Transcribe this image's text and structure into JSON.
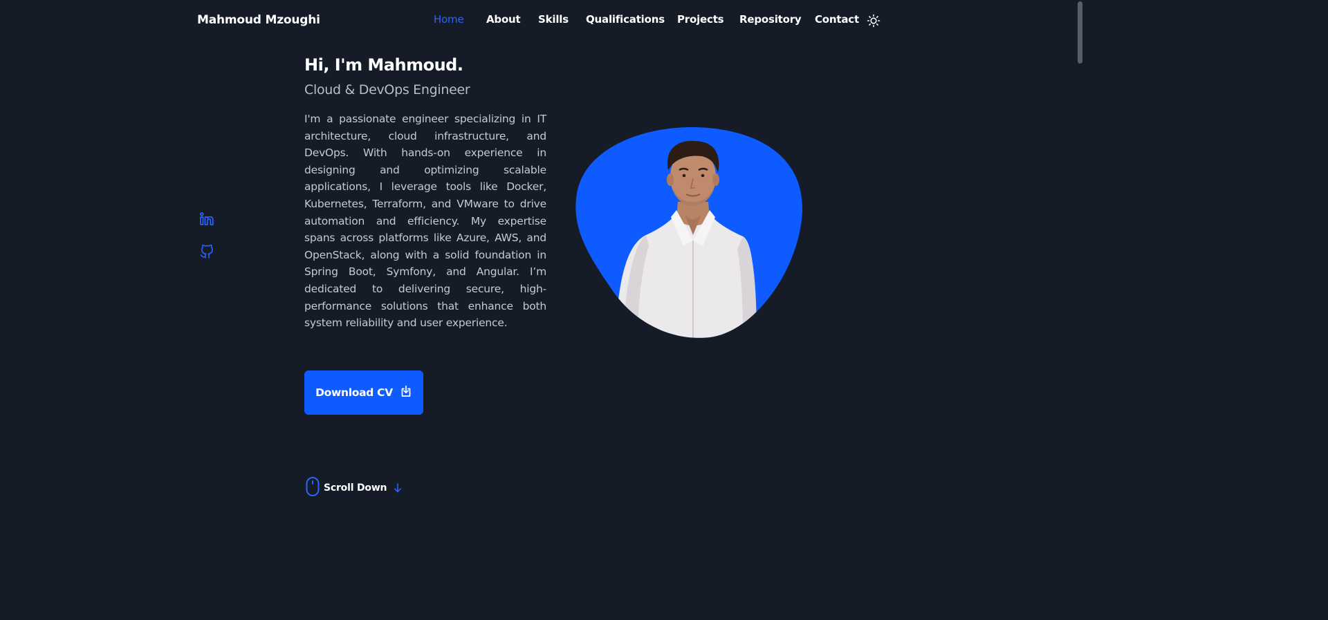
{
  "header": {
    "brand": "Mahmoud Mzoughi",
    "nav": [
      {
        "label": "Home",
        "active": true
      },
      {
        "label": "About",
        "active": false
      },
      {
        "label": "Skills",
        "active": false
      },
      {
        "label": "Qualifications",
        "active": false
      },
      {
        "label": "Projects",
        "active": false
      },
      {
        "label": "Repository",
        "active": false
      },
      {
        "label": "Contact",
        "active": false
      }
    ],
    "theme_icon": "sun-icon"
  },
  "socials": [
    {
      "icon": "linkedin-icon"
    },
    {
      "icon": "github-icon"
    }
  ],
  "hero": {
    "title": "Hi, I'm Mahmoud.",
    "subtitle": "Cloud & DevOps Engineer",
    "description": "I'm a passionate engineer specializing in IT architecture, cloud infrastructure, and DevOps. With hands-on experience in designing and optimizing scalable applications, I leverage tools like Docker, Kubernetes, Terraform, and VMware to drive automation and efficiency. My expertise spans across platforms like Azure, AWS, and OpenStack, along with a solid foundation in Spring Boot, Symfony, and Angular. I’m dedicated to delivering secure, high-performance solutions that enhance both system reliability and user experience.",
    "cv_button": "Download CV",
    "cv_icon": "download-icon",
    "scroll_label": "Scroll Down"
  },
  "colors": {
    "background": "#151b27",
    "accent": "#0e5cff",
    "active_nav": "#2a64ff",
    "text": "#ffffff",
    "muted": "#c6cad2"
  }
}
